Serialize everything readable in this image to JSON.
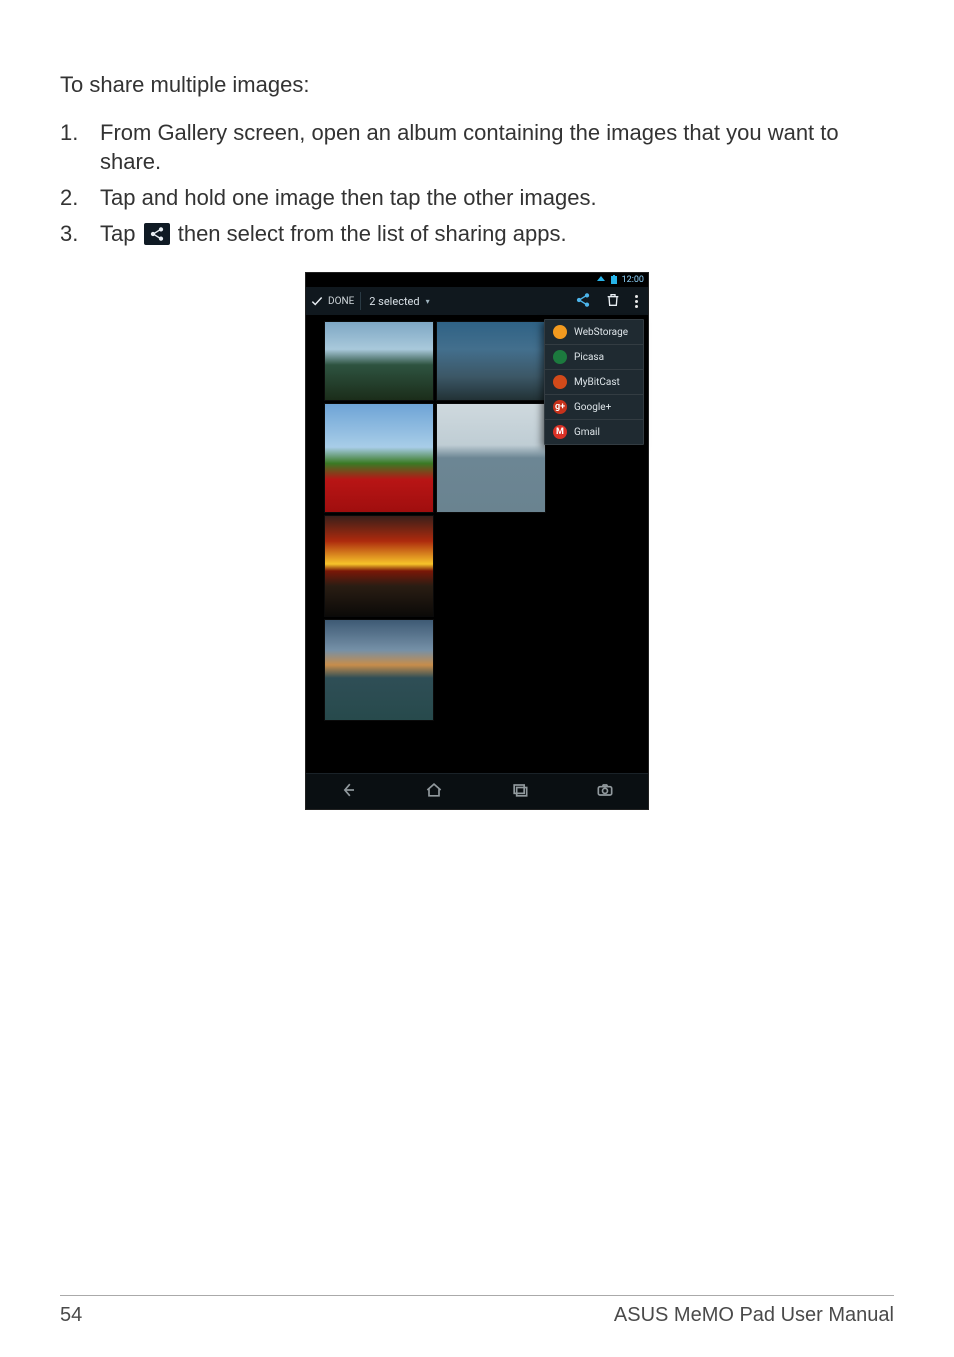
{
  "intro": "To share multiple images:",
  "steps": [
    {
      "num": "1.",
      "text": "From Gallery screen, open an album containing the images that you want to share."
    },
    {
      "num": "2.",
      "text": "Tap and hold one image then tap the other images."
    },
    {
      "num": "3.",
      "pre": "Tap ",
      "post": " then select from the list of sharing apps."
    }
  ],
  "device": {
    "status_time": "12:00",
    "topbar": {
      "done": "DONE",
      "title": "2 selected"
    },
    "share_menu": [
      {
        "label": "WebStorage",
        "icon_bg": "#f29a1f",
        "icon_color": "#fff"
      },
      {
        "label": "Picasa",
        "icon_bg": "#1c7a3e",
        "icon_color": "#fff"
      },
      {
        "label": "MyBitCast",
        "icon_bg": "#d24a1a",
        "icon_color": "#fff"
      },
      {
        "label": "Google+",
        "icon_bg": "#c6321b",
        "icon_color": "#fff",
        "glyph": "g+"
      },
      {
        "label": "Gmail",
        "icon_bg": "#d93025",
        "icon_color": "#fff",
        "glyph": "M"
      }
    ]
  },
  "footer": {
    "page": "54",
    "title": "ASUS MeMO Pad User Manual"
  }
}
